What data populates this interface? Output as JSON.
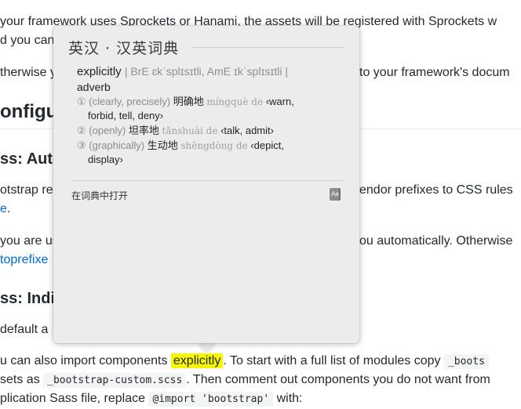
{
  "doc": {
    "line1": "your framework uses Sprockets or Hanami, the assets will be registered with Sprockets w",
    "line2": "d you can",
    "line3_left": "therwise y",
    "line3_right": "to your framework's docum",
    "heading_config": "onfigu",
    "heading_sass_auto": "ss: Auto",
    "line5_left": "otstrap re",
    "line5_right": "endor prefixes to CSS rules",
    "line6_link": "e",
    "line6_end": ".",
    "line7_left": "you are us",
    "line7_right": "ou automatically. Otherwise",
    "line8_link": "toprefixe",
    "heading_sass_indiv": "ss: Indi",
    "line9": " default a",
    "line10_before": "u can also import components ",
    "line10_highlight": "explicitly",
    "line10_after": ". To start with a full list of modules copy ",
    "line10_code": "_boots",
    "line11_before": "sets as ",
    "line11_code": "_bootstrap-custom.scss",
    "line11_after": ". Then comment out components you do not want from",
    "line12_before": "plication Sass file, replace ",
    "line12_code": "@import 'bootstrap'",
    "line12_after": " with:"
  },
  "popover": {
    "title": "英汉 · 汉英词典",
    "headword": "explicitly",
    "pron": "| BrE ɛkˈsplɪsɪtli,   AmE ɪkˈsplɪsɪtli |",
    "pos": "adverb",
    "senses": [
      {
        "num": "①",
        "gloss": "(clearly, precisely)",
        "zh": "明确地",
        "pinyin": "míngquè de",
        "ex1": "‹warn,",
        "ex2": "forbid, tell, deny›"
      },
      {
        "num": "②",
        "gloss": "(openly)",
        "zh": "坦率地",
        "pinyin": "tǎnshuài de",
        "ex1": "‹talk, admit›",
        "ex2": ""
      },
      {
        "num": "③",
        "gloss": "(graphically)",
        "zh": "生动地",
        "pinyin": "shēngdòng de",
        "ex1": "‹depict,",
        "ex2": "display›"
      }
    ],
    "open_in_dictionary": "在词典中打开",
    "dict_icon_label": "Aa"
  }
}
